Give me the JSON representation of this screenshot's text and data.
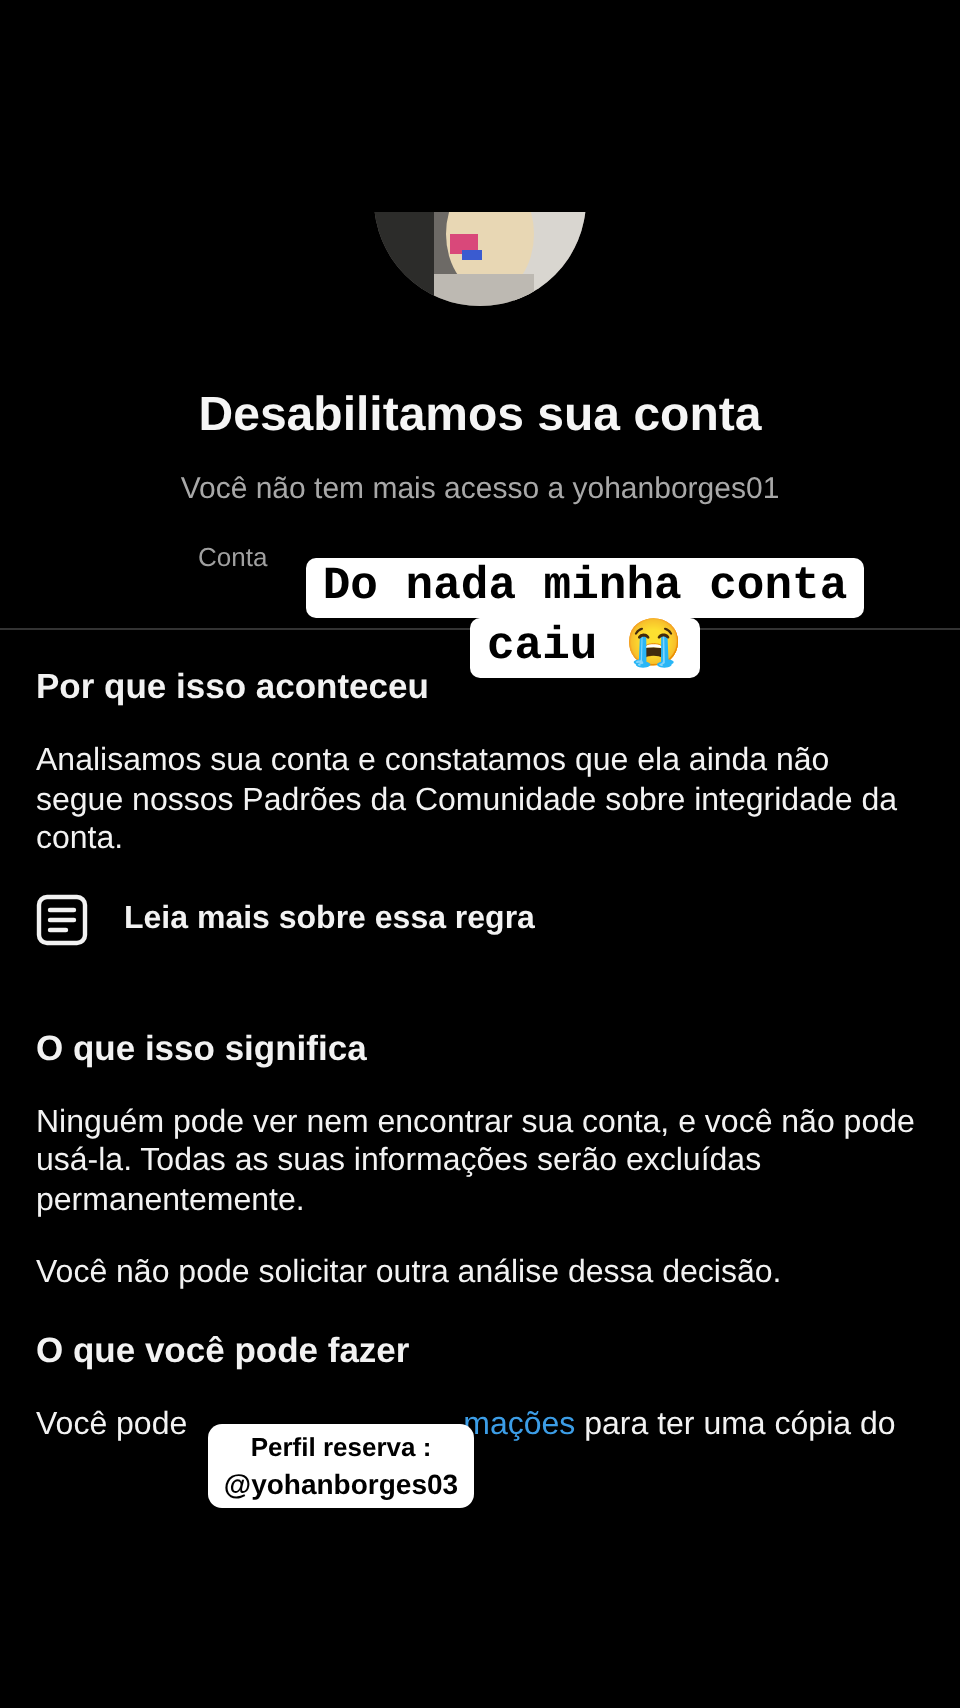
{
  "profile": {
    "kind": "picture"
  },
  "title": "Desabilitamos sua conta",
  "subtitle": "Você não tem mais acesso a yohanborges01",
  "date_line": "Conta",
  "caption_sticker": [
    "Do nada minha conta",
    "caiu 😭"
  ],
  "sections": [
    {
      "heading": "Por que isso aconteceu",
      "paragraphs": [
        "Analisamos sua conta e constatamos que ela ainda não segue nossos Padrões da Comunidade sobre integridade da conta."
      ],
      "link": "Leia mais sobre essa regra"
    },
    {
      "heading": "O que isso significa",
      "paragraphs": [
        "Ninguém pode ver nem encontrar sua conta, e você não pode usá-la. Todas as suas informações serão excluídas permanentemente.",
        "Você não pode solicitar outra análise dessa decisão."
      ]
    },
    {
      "heading": "O que você pode fazer",
      "line": {
        "before": "Você pode",
        "link": "mações",
        "after": "para ter uma cópia do"
      }
    }
  ],
  "reserve_sticker": {
    "lines": [
      "Perfil reserva :",
      "@yohanborges03"
    ]
  }
}
